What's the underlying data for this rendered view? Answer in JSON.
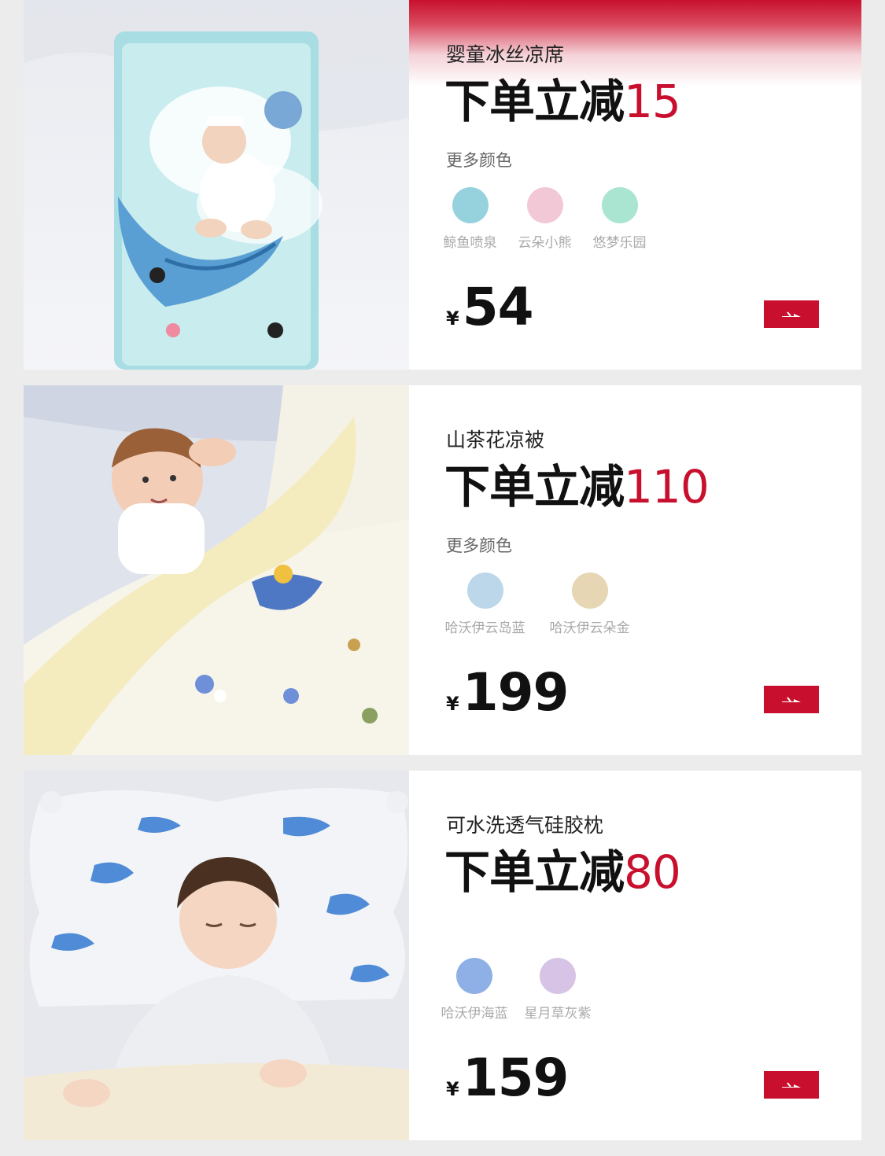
{
  "theme": {
    "accent": "#c8102e",
    "background": "#ececec"
  },
  "products": [
    {
      "name": "婴童冰丝凉席",
      "promo_prefix": "下单立减",
      "promo_amount": "15",
      "more_colors_label": "更多颜色",
      "swatches": [
        {
          "label": "鲸鱼喷泉",
          "color": "#95d2de"
        },
        {
          "label": "云朵小熊",
          "color": "#f3c8d6"
        },
        {
          "label": "悠梦乐园",
          "color": "#a9e5d1"
        }
      ],
      "currency": "¥",
      "price": "54",
      "image": "baby-on-whale-print-mat"
    },
    {
      "name": "山茶花凉被",
      "promo_prefix": "下单立减",
      "promo_amount": "110",
      "more_colors_label": "更多颜色",
      "swatches": [
        {
          "label": "哈沃伊云岛蓝",
          "color": "#bcd6ea"
        },
        {
          "label": "哈沃伊云朵金",
          "color": "#e6d6b3"
        }
      ],
      "currency": "¥",
      "price": "199",
      "image": "toddler-under-yellow-quilt"
    },
    {
      "name": "可水洗透气硅胶枕",
      "promo_prefix": "下单立减",
      "promo_amount": "80",
      "more_colors_label": "",
      "swatches": [
        {
          "label": "哈沃伊海蓝",
          "color": "#8fb0e6"
        },
        {
          "label": "星月草灰紫",
          "color": "#d6c3e6"
        }
      ],
      "currency": "¥",
      "price": "159",
      "image": "child-sleeping-on-whale-pillow"
    }
  ]
}
